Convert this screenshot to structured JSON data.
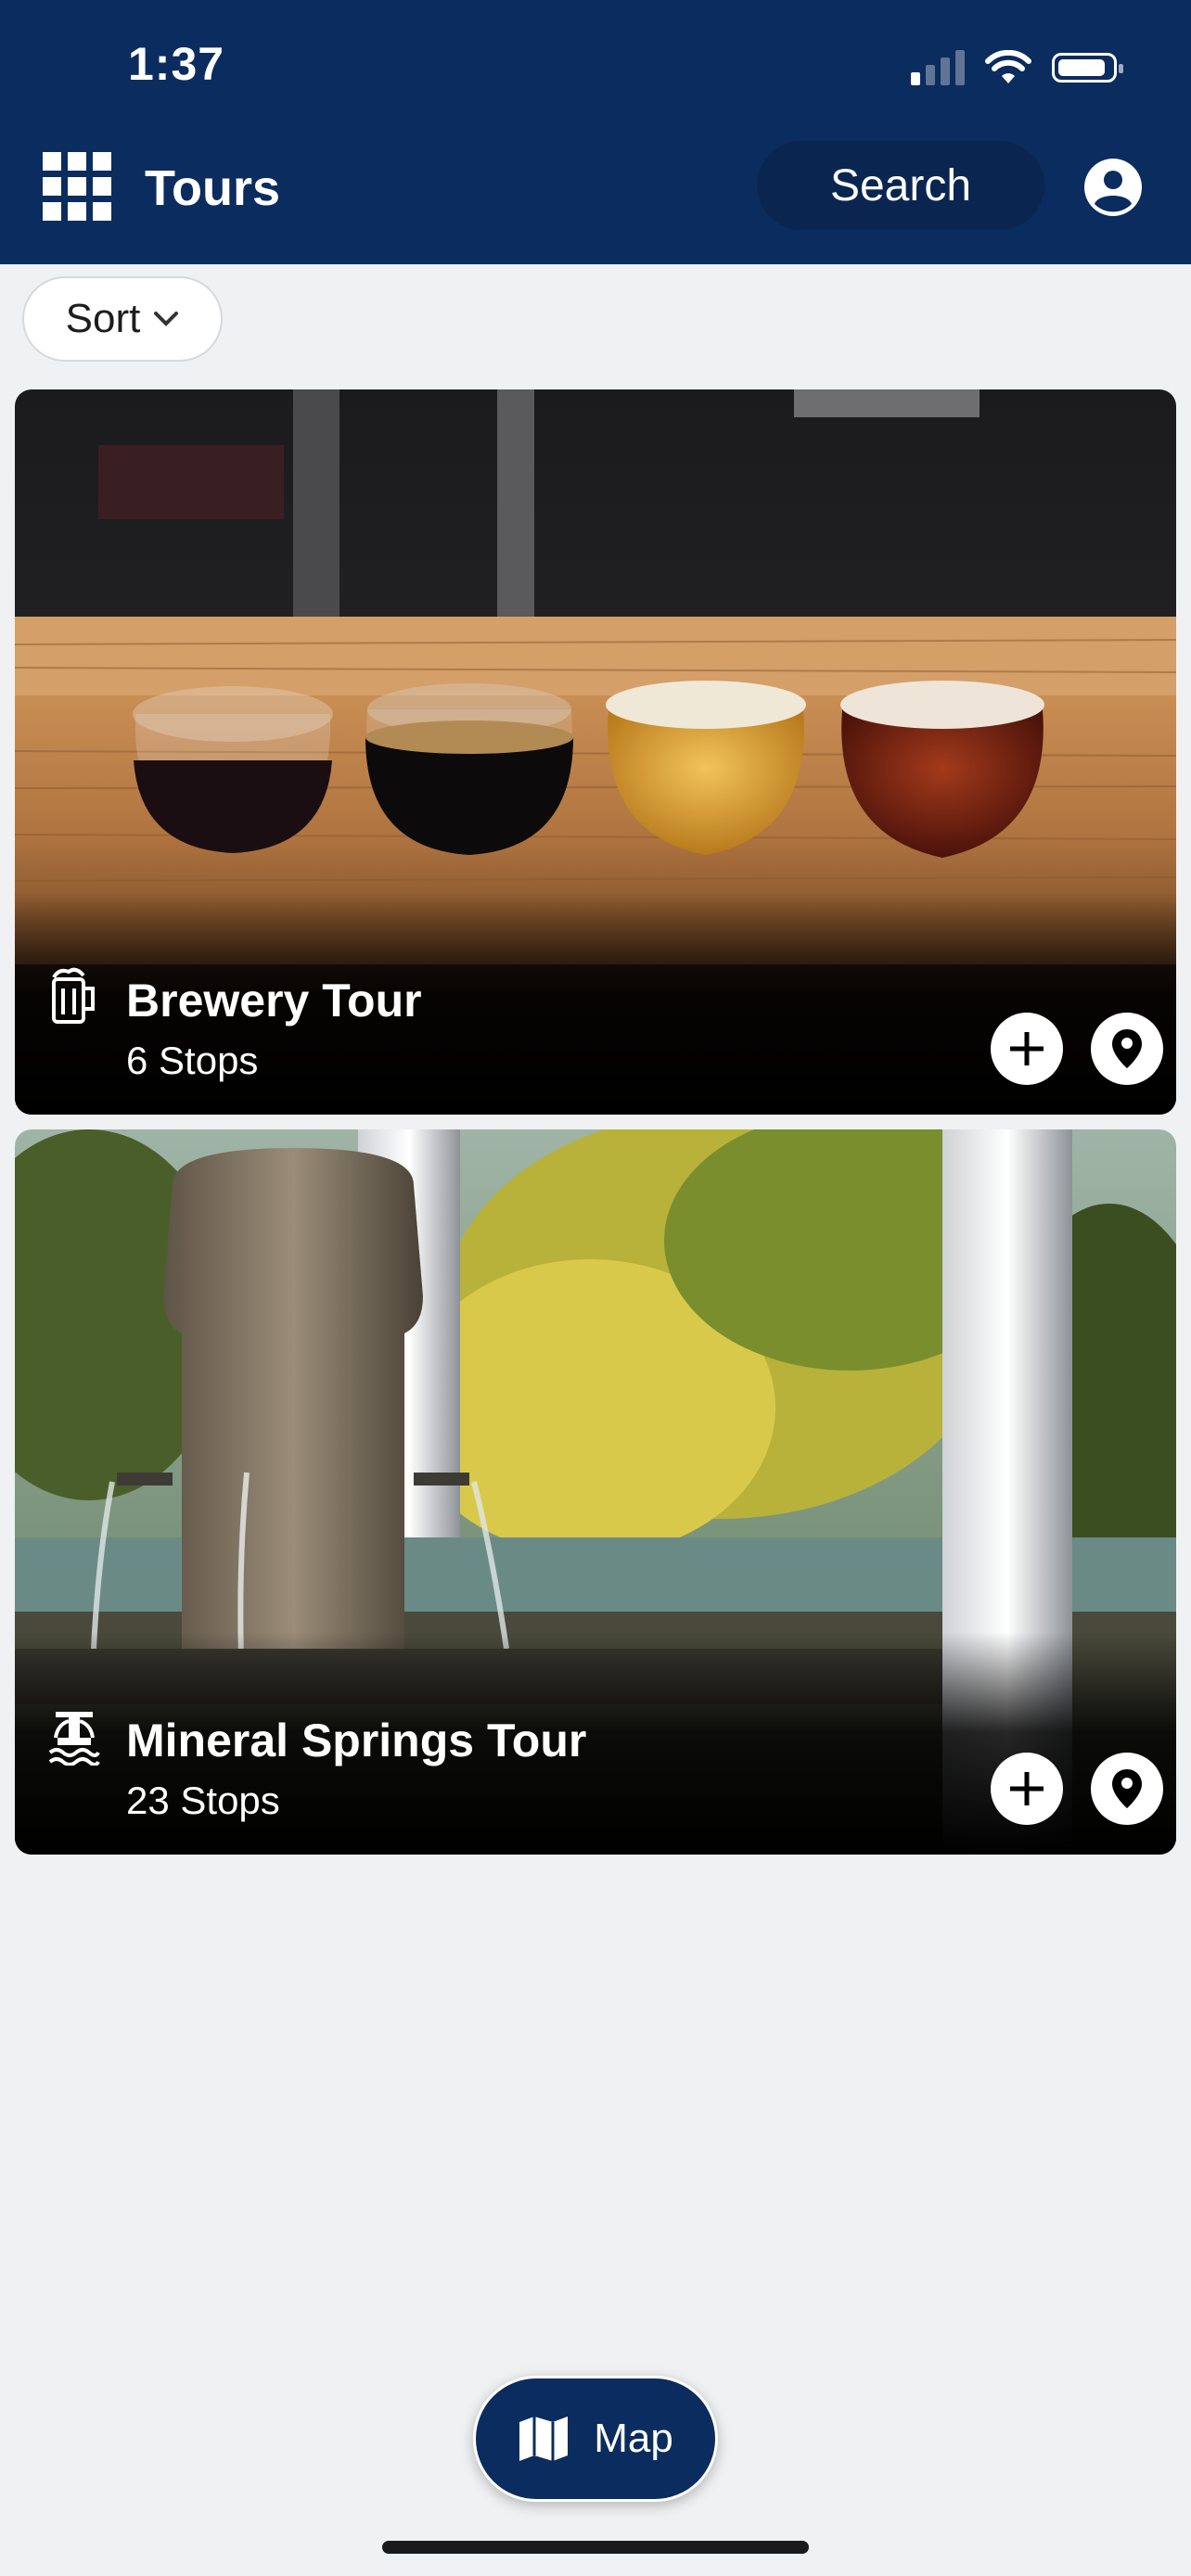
{
  "status_bar": {
    "time": "1:37"
  },
  "header": {
    "title": "Tours",
    "search_label": "Search"
  },
  "toolbar": {
    "sort_label": "Sort"
  },
  "tours": [
    {
      "title": "Brewery Tour",
      "stops": "6 Stops",
      "icon": "beer-mug-icon"
    },
    {
      "title": "Mineral Springs Tour",
      "stops": "23 Stops",
      "icon": "spring-fountain-icon"
    }
  ],
  "map_button": {
    "label": "Map"
  },
  "colors": {
    "header": "#0b2c5e",
    "background": "#f0f1f3"
  }
}
